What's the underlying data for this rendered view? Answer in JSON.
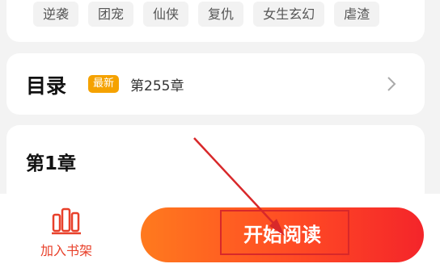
{
  "tags": [
    "逆袭",
    "团宠",
    "仙侠",
    "复仇",
    "女生玄幻",
    "虐渣"
  ],
  "catalog": {
    "title": "目录",
    "badge": "最新",
    "latest_chapter": "第255章"
  },
  "chapter": {
    "title": "第1章"
  },
  "bottom_bar": {
    "shelf_label": "加入书架",
    "read_label": "开始阅读"
  },
  "colors": {
    "accent": "#f4252a",
    "badge": "#f5a200",
    "annotation": "#d8282a"
  }
}
